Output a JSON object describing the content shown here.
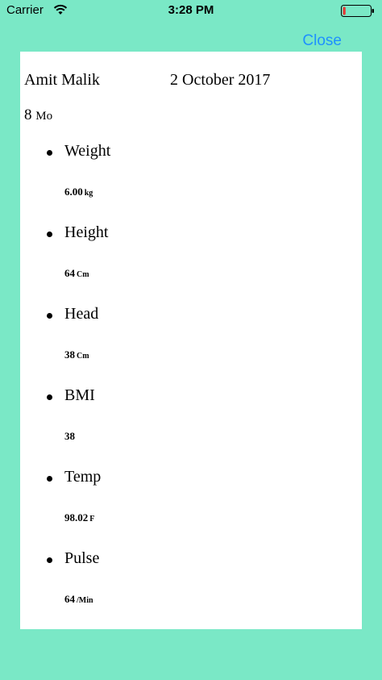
{
  "status_bar": {
    "carrier": "Carrier",
    "time": "3:28 PM",
    "icons": [
      "wifi-icon",
      "battery-icon"
    ],
    "battery_level": 0.1
  },
  "header": {
    "close_label": "Close"
  },
  "card": {
    "name": "Amit Malik",
    "date": "2 October 2017",
    "age_value": "8",
    "age_unit": "Mo",
    "metrics": [
      {
        "label": "Weight",
        "value": "6.00",
        "unit": "kg"
      },
      {
        "label": "Height",
        "value": "64",
        "unit": "Cm"
      },
      {
        "label": "Head",
        "value": "38",
        "unit": "Cm"
      },
      {
        "label": "BMI",
        "value": "38",
        "unit": ""
      },
      {
        "label": "Temp",
        "value": "98.02",
        "unit": "F"
      },
      {
        "label": "Pulse",
        "value": "64",
        "unit": "/Min"
      }
    ]
  },
  "colors": {
    "background": "#7ae8c6",
    "card": "#ffffff",
    "accent": "#1e90ff",
    "battery_low": "#e53935"
  }
}
